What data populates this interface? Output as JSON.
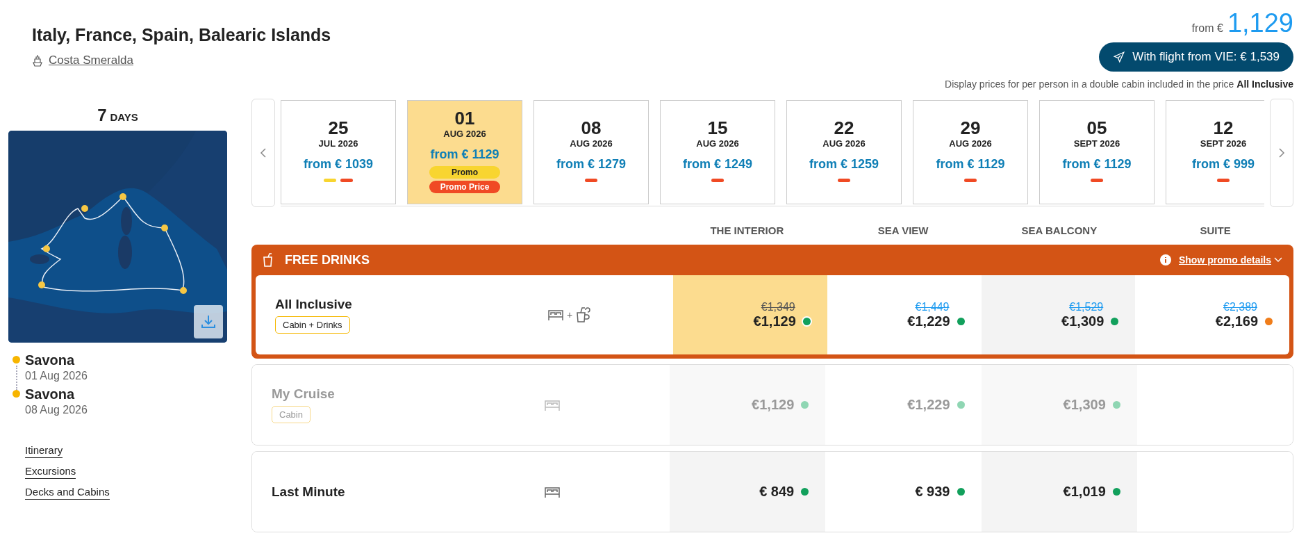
{
  "header": {
    "title": "Italy, France, Spain, Balearic Islands",
    "ship": "Costa Smeralda",
    "from_label": "from €",
    "from_price": "1,129",
    "flight_button": "With flight from VIE: € 1,539",
    "note": "Display prices for per person in a double cabin included in the price **All Inclusive**"
  },
  "sidebar": {
    "days_number": "7",
    "days_label": "DAYS",
    "map": {
      "kind": "picture"
    },
    "stops": [
      {
        "port": "Savona",
        "date": "01 Aug 2026"
      },
      {
        "port": "Savona",
        "date": "08 Aug 2026"
      }
    ],
    "links": [
      "Itinerary",
      "Excursions",
      "Decks and Cabins"
    ]
  },
  "dates": [
    {
      "day": "25",
      "month": "JUL 2026",
      "price": "from € 1039",
      "selected": false,
      "markers": [
        {
          "color": "#f8d530"
        },
        {
          "color": "#f04a24"
        }
      ]
    },
    {
      "day": "01",
      "month": "AUG 2026",
      "price": "from € 1129",
      "selected": true,
      "badges": [
        {
          "label": "Promo",
          "color": "#f8d530"
        },
        {
          "label": "Promo Price",
          "color": "#f04a24"
        }
      ]
    },
    {
      "day": "08",
      "month": "AUG 2026",
      "price": "from € 1279",
      "selected": false,
      "markers": [
        {
          "color": "#f04a24"
        }
      ]
    },
    {
      "day": "15",
      "month": "AUG 2026",
      "price": "from € 1249",
      "selected": false,
      "markers": [
        {
          "color": "#f04a24"
        }
      ]
    },
    {
      "day": "22",
      "month": "AUG 2026",
      "price": "from € 1259",
      "selected": false,
      "markers": [
        {
          "color": "#f04a24"
        }
      ]
    },
    {
      "day": "29",
      "month": "AUG 2026",
      "price": "from € 1129",
      "selected": false,
      "markers": [
        {
          "color": "#f04a24"
        }
      ]
    },
    {
      "day": "05",
      "month": "SEPT 2026",
      "price": "from € 1129",
      "selected": false,
      "markers": [
        {
          "color": "#f04a24"
        }
      ]
    },
    {
      "day": "12",
      "month": "SEPT 2026",
      "price": "from € 999",
      "selected": false,
      "markers": [
        {
          "color": "#f04a24"
        }
      ]
    }
  ],
  "columns": [
    "THE INTERIOR",
    "SEA VIEW",
    "SEA BALCONY",
    "SUITE"
  ],
  "promo": {
    "title": "FREE DRINKS",
    "link": "Show promo details"
  },
  "rates": [
    {
      "name": "All Inclusive",
      "tag": "Cabin + Drinks",
      "kind": "cabin_drinks",
      "joiner": "+",
      "promo": true,
      "disabled": false,
      "prices": [
        {
          "old": "€1,349",
          "price": "€1,129",
          "color": "#12a05c",
          "selected": true
        },
        {
          "old": "€1,449",
          "price": "€1,229",
          "color": "#12a05c",
          "selected": false
        },
        {
          "old": "€1,529",
          "price": "€1,309",
          "color": "#12a05c",
          "selected": false
        },
        {
          "old": "€2,389",
          "price": "€2,169",
          "color": "#f07d1a",
          "selected": false
        }
      ]
    },
    {
      "name": "My Cruise",
      "tag": "Cabin",
      "kind": "cabin",
      "promo": false,
      "disabled": true,
      "prices": [
        {
          "price": "€1,129",
          "color": "#8fd6b3",
          "selected": false
        },
        {
          "price": "€1,229",
          "color": "#8fd6b3",
          "selected": false
        },
        {
          "price": "€1,309",
          "color": "#8fd6b3",
          "selected": false
        }
      ]
    },
    {
      "name": "Last Minute",
      "kind": "cabin",
      "promo": false,
      "disabled": false,
      "prices": [
        {
          "price": "€ 849",
          "color": "#12a05c",
          "selected": false
        },
        {
          "price": "€ 939",
          "color": "#12a05c",
          "selected": false
        },
        {
          "price": "€1,019",
          "color": "#12a05c",
          "selected": false
        }
      ]
    }
  ]
}
